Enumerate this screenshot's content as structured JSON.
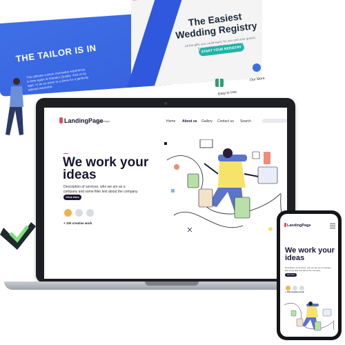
{
  "background": {
    "tailor": {
      "title": "THE TAILOR IS IN",
      "description": "The ultimate custom menswear experience is here again at Hawaii's Quality. Visit us by appt. or as an event in a dress for a perfectly tailored wardrobe."
    },
    "wedding": {
      "title": "The Easiest Wedding Registry",
      "description": "All the gifts you could want, for you and your guests, free wedding websites, and more.",
      "button": "START YOUR REGISTRY",
      "features": [
        "Easy to Use",
        "Our Store"
      ]
    }
  },
  "laptop": {
    "logo": "LandingPage",
    "logo_sub": "by Design",
    "nav": [
      "Home",
      "About us",
      "Gallery",
      "Contact us",
      "Search"
    ],
    "hero_title": "We work your ideas",
    "hero_description": "Description of services, who we are as a company and some filler text about the company",
    "cta": "Click Here",
    "creative": "+ 100 creative work"
  },
  "phone": {
    "logo": "LandingPage",
    "logo_sub": "by Design",
    "hero_title": "We work your ideas",
    "hero_description": "Description of services, who we are as a company and some filler text about the company",
    "cta": "Click Here",
    "creative": "+ 100 creative work"
  },
  "colors": {
    "brand_blue": "#2f58de",
    "dark": "#1b1530",
    "accent_red": "#e84b5b",
    "teal": "#21b3a8",
    "illustration_yellow": "#f5e36a",
    "illustration_blue": "#5a74c9"
  }
}
